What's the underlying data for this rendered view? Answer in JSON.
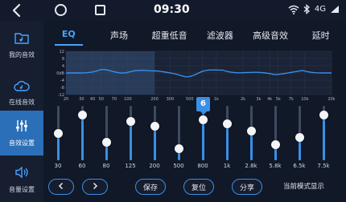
{
  "status": {
    "time": "09:30",
    "network": "4G"
  },
  "sidebar": {
    "items": [
      {
        "label": "我的音效",
        "icon": "music-folder-icon",
        "active": false
      },
      {
        "label": "在线音效",
        "icon": "cloud-music-icon",
        "active": false
      },
      {
        "label": "音效设置",
        "icon": "equalizer-sliders-icon",
        "active": true
      },
      {
        "label": "音量设置",
        "icon": "speaker-volume-icon",
        "active": false
      }
    ]
  },
  "tabs": [
    {
      "label": "EQ",
      "active": true
    },
    {
      "label": "声场",
      "active": false
    },
    {
      "label": "超重低音",
      "active": false
    },
    {
      "label": "滤波器",
      "active": false
    },
    {
      "label": "高级音效",
      "active": false
    },
    {
      "label": "延时",
      "active": false
    }
  ],
  "graph": {
    "y_ticks": [
      "12",
      "8",
      "4",
      "0dB",
      "-4",
      "-8",
      "-12"
    ],
    "x_ticks": [
      "20",
      "30",
      "40",
      "50",
      "70",
      "100",
      "200",
      "300",
      "500",
      "700",
      "1k",
      "2k",
      "3k",
      "4k",
      "5k",
      "7k",
      "10k",
      "20k"
    ]
  },
  "eq": {
    "min": -12,
    "max": 12,
    "selected_index": 6,
    "bands": [
      {
        "freq": "30",
        "gain": 0
      },
      {
        "freq": "60",
        "gain": 8
      },
      {
        "freq": "80",
        "gain": -4
      },
      {
        "freq": "125",
        "gain": 5
      },
      {
        "freq": "200",
        "gain": 3
      },
      {
        "freq": "500",
        "gain": -7
      },
      {
        "freq": "800",
        "gain": 6
      },
      {
        "freq": "1k",
        "gain": 4
      },
      {
        "freq": "2.8k",
        "gain": 1
      },
      {
        "freq": "5.8k",
        "gain": -5
      },
      {
        "freq": "6.5k",
        "gain": -2
      },
      {
        "freq": "7.5k",
        "gain": 8
      }
    ]
  },
  "buttons": {
    "save": "保存",
    "reset": "复位",
    "share": "分享",
    "mode_label": "当前模式显示"
  }
}
